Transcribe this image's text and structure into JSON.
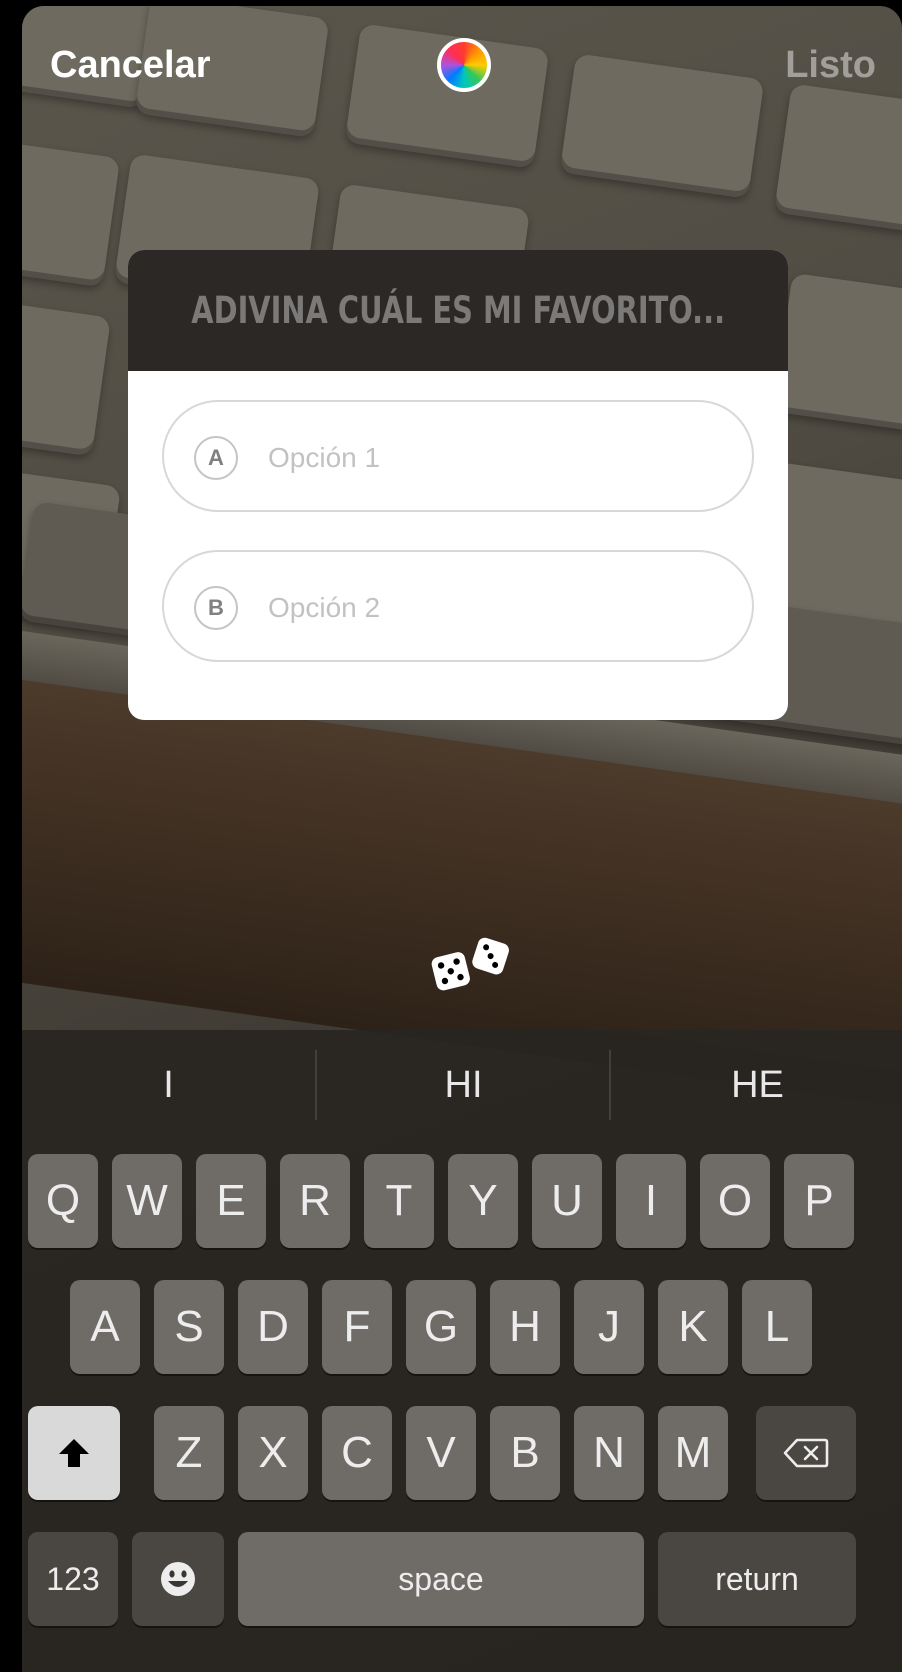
{
  "header": {
    "cancel_label": "Cancelar",
    "done_label": "Listo",
    "color_wheel_icon": "color-wheel-icon"
  },
  "quiz": {
    "title": "ADIVINA CUÁL ES MI FAVORITO...",
    "options": [
      {
        "letter": "A",
        "placeholder": "Opción 1"
      },
      {
        "letter": "B",
        "placeholder": "Opción 2"
      }
    ],
    "shuffle_icon": "dice-icon"
  },
  "keyboard": {
    "suggestions": [
      "I",
      "HI",
      "HE"
    ],
    "row1": [
      "Q",
      "W",
      "E",
      "R",
      "T",
      "Y",
      "U",
      "I",
      "O",
      "P"
    ],
    "row2": [
      "A",
      "S",
      "D",
      "F",
      "G",
      "H",
      "J",
      "K",
      "L"
    ],
    "row3": [
      "Z",
      "X",
      "C",
      "V",
      "B",
      "N",
      "M"
    ],
    "shift_icon": "shift-arrow-icon",
    "delete_icon": "delete-icon",
    "numbers_label": "123",
    "emoji_icon": "emoji-icon",
    "space_label": "space",
    "return_label": "return"
  },
  "colors": {
    "quiz_header": "#2b2826",
    "keyboard_bg": "#282521",
    "key": "#6f6b67",
    "shift_key": "#d9d9d9"
  }
}
